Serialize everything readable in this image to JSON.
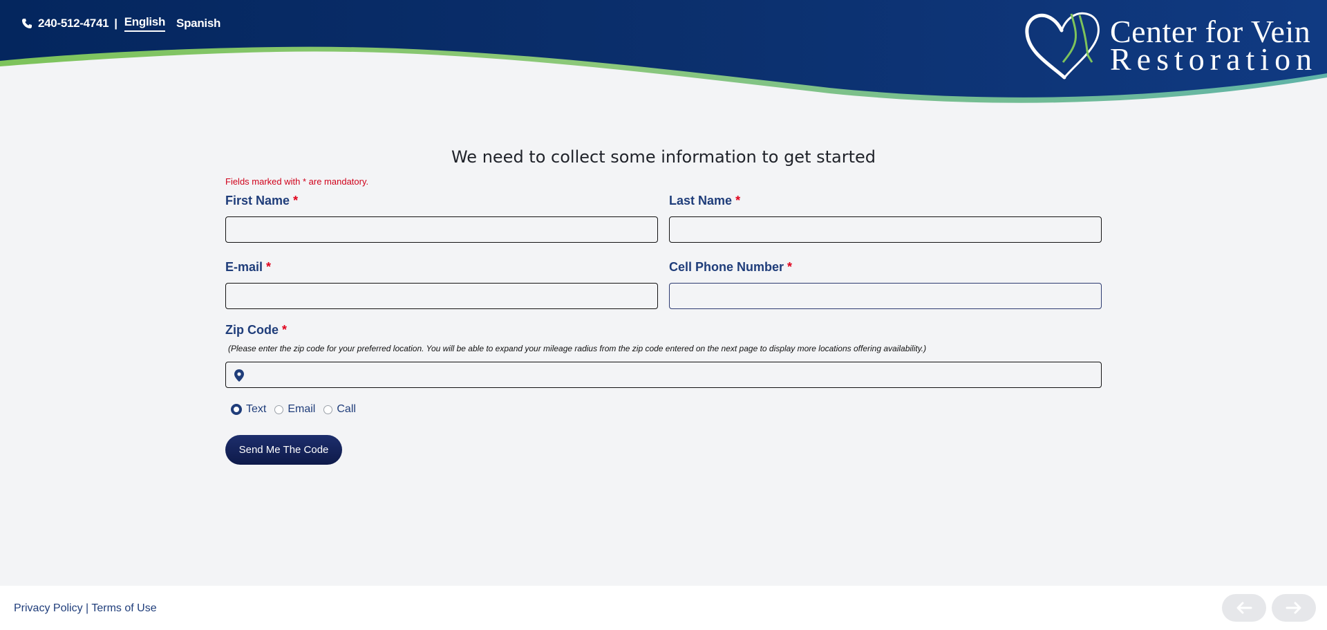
{
  "header": {
    "phone": "240-512-4741",
    "separator": "|",
    "languages": [
      {
        "label": "English",
        "active": true
      },
      {
        "label": "Spanish",
        "active": false
      }
    ],
    "logo_line1": "Center for Vein",
    "logo_line2": "Restoration"
  },
  "form": {
    "title": "We need to collect some information to get started",
    "mandatory_note": "Fields marked with * are mandatory.",
    "required_marker": "*",
    "first_name": {
      "label": "First Name",
      "value": ""
    },
    "last_name": {
      "label": "Last Name",
      "value": ""
    },
    "email": {
      "label": "E-mail",
      "value": ""
    },
    "cell_phone": {
      "label": "Cell Phone Number",
      "value": ""
    },
    "zip_code": {
      "label": "Zip Code",
      "note": "(Please enter the zip code for your preferred location. You will be able to expand your mileage radius from the zip code entered on the next page to display more locations offering availability.)",
      "value": ""
    },
    "contact_methods": [
      {
        "label": "Text",
        "checked": true
      },
      {
        "label": "Email",
        "checked": false
      },
      {
        "label": "Call",
        "checked": false
      }
    ],
    "submit_label": "Send Me The Code"
  },
  "footer": {
    "privacy": "Privacy Policy",
    "separator": "|",
    "terms": "Terms of Use",
    "prev_icon": "arrow-left-icon",
    "next_icon": "arrow-right-icon"
  },
  "colors": {
    "header_dark": "#04265e",
    "header_light": "#123d8a",
    "wave_green": "#7dc35b",
    "wave_teal": "#5fb3a8",
    "label_blue": "#1f3d7a",
    "required_red": "#e0001b",
    "button_navy": "#14245a"
  }
}
